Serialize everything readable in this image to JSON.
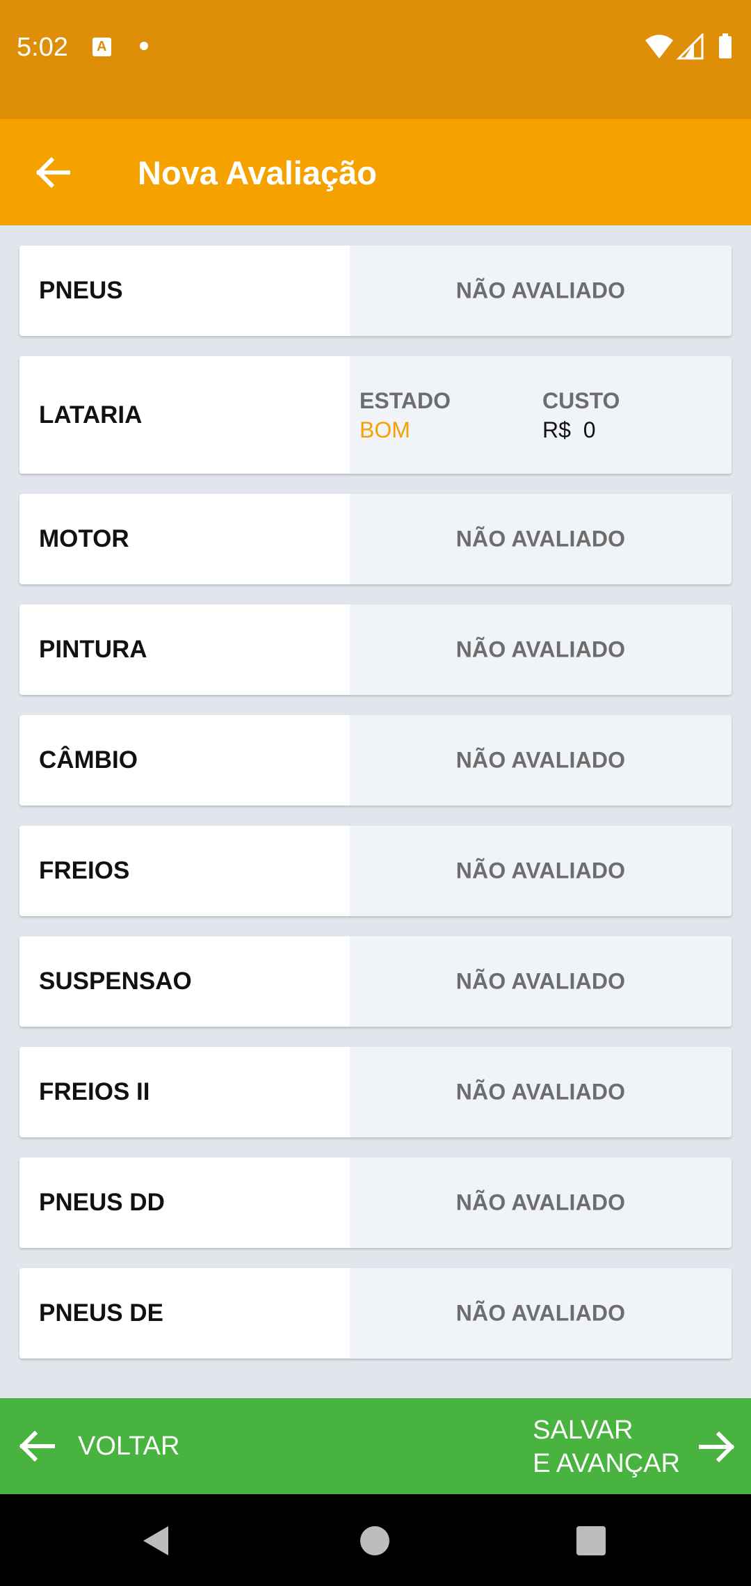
{
  "status_bar": {
    "time": "5:02",
    "notification_icon": "a-icon",
    "notification_icon_letter": "A",
    "dot_icon": "dot-icon",
    "icons": [
      "wifi-icon",
      "signal-icon",
      "battery-icon"
    ]
  },
  "app_bar": {
    "title": "Nova Avaliação",
    "back_icon": "arrow-left-icon"
  },
  "items": [
    {
      "label": "PNEUS",
      "status": "NÃO AVALIADO"
    },
    {
      "label": "LATARIA",
      "estado_label": "ESTADO",
      "estado_value": "BOM",
      "custo_label": "CUSTO",
      "custo_value": "R$  0"
    },
    {
      "label": "MOTOR",
      "status": "NÃO AVALIADO"
    },
    {
      "label": "PINTURA",
      "status": "NÃO AVALIADO"
    },
    {
      "label": "CÂMBIO",
      "status": "NÃO AVALIADO"
    },
    {
      "label": "FREIOS",
      "status": "NÃO AVALIADO"
    },
    {
      "label": "SUSPENSAO",
      "status": "NÃO AVALIADO"
    },
    {
      "label": "FREIOS II",
      "status": "NÃO AVALIADO"
    },
    {
      "label": "PNEUS DD",
      "status": "NÃO AVALIADO"
    },
    {
      "label": "PNEUS DE",
      "status": "NÃO AVALIADO"
    }
  ],
  "footer": {
    "back_label": "VOLTAR",
    "save_line1": "SALVAR",
    "save_line2": "E AVANÇAR"
  },
  "nav_bar": {
    "icons": [
      "nav-back-icon",
      "nav-home-icon",
      "nav-recents-icon"
    ]
  },
  "colors": {
    "status_bar": "#df8e07",
    "app_bar": "#f5a200",
    "background": "#e1e6ec",
    "estado_value": "#f5a200",
    "footer": "#49b340",
    "muted_text": "#6d6d6d"
  }
}
